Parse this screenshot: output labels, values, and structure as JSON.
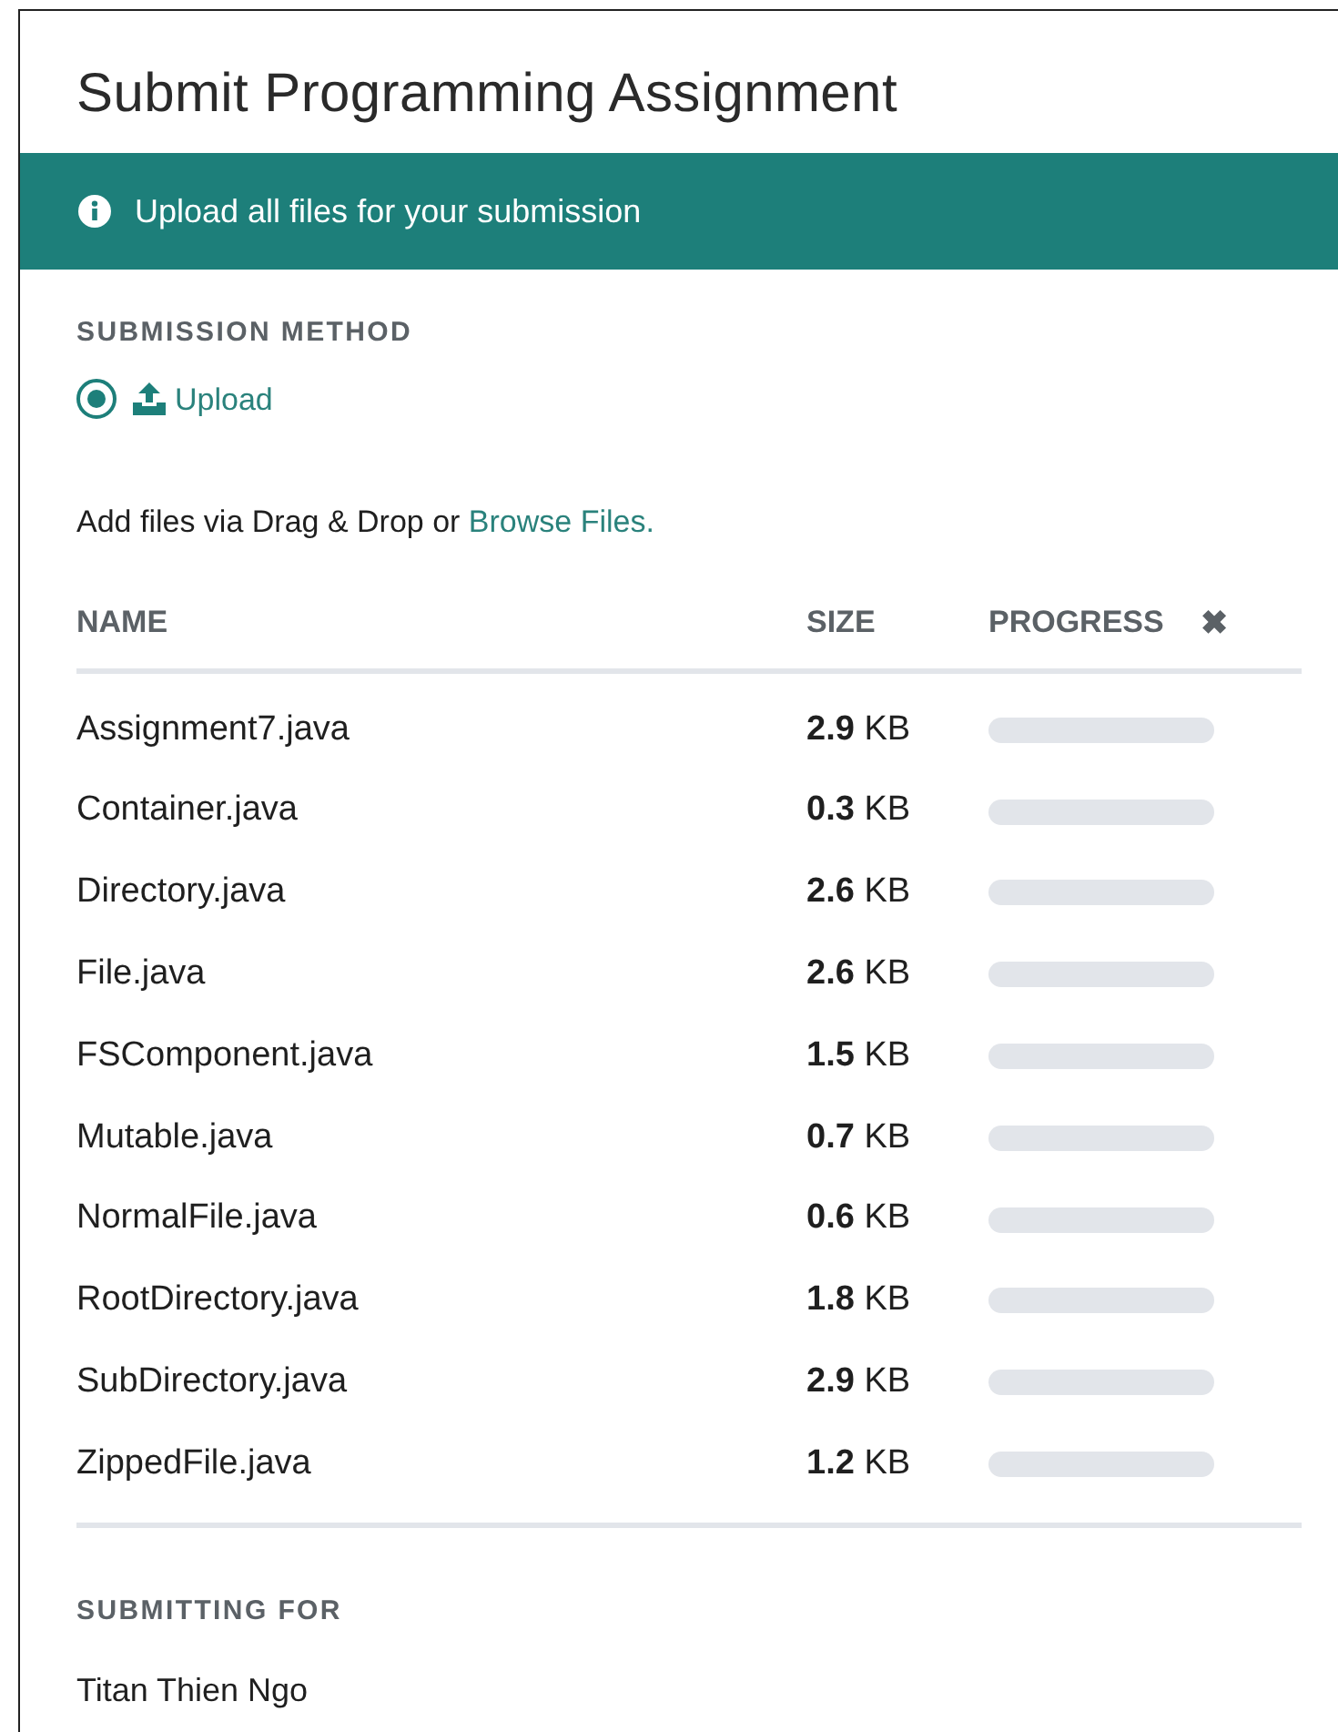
{
  "title": "Submit Programming Assignment",
  "banner": {
    "text": "Upload all files for your submission"
  },
  "submission_method": {
    "label": "SUBMISSION METHOD",
    "options": [
      {
        "label": "Upload",
        "selected": true
      }
    ]
  },
  "instructions": {
    "text": "Add files via Drag & Drop or ",
    "link": "Browse Files."
  },
  "table": {
    "columns": [
      "NAME",
      "SIZE",
      "PROGRESS"
    ],
    "clear_icon": "✖",
    "rows": [
      {
        "name": "Assignment7.java",
        "size": "**2.9** KB",
        "level": 0
      },
      {
        "name": "Container.java",
        "size": "**0.3** KB",
        "level": 0
      },
      {
        "name": "Directory.java",
        "size": "**2.6** KB",
        "level": 0
      },
      {
        "name": "File.java",
        "size": "**2.6** KB",
        "level": 0
      },
      {
        "name": "FSComponent.java",
        "size": "**1.5** KB",
        "level": 0
      },
      {
        "name": "Mutable.java",
        "size": "**0.7** KB",
        "level": 0
      },
      {
        "name": "NormalFile.java",
        "size": "**0.6** KB",
        "level": 0
      },
      {
        "name": "RootDirectory.java",
        "size": "**1.8** KB",
        "level": 0
      },
      {
        "name": "SubDirectory.java",
        "size": "**2.9** KB",
        "level": 0
      },
      {
        "name": "ZippedFile.java",
        "size": "**1.2** KB",
        "level": 0
      }
    ]
  },
  "submitting_for": {
    "label": "SUBMITTING FOR",
    "name": "Titan Thien Ngo"
  }
}
